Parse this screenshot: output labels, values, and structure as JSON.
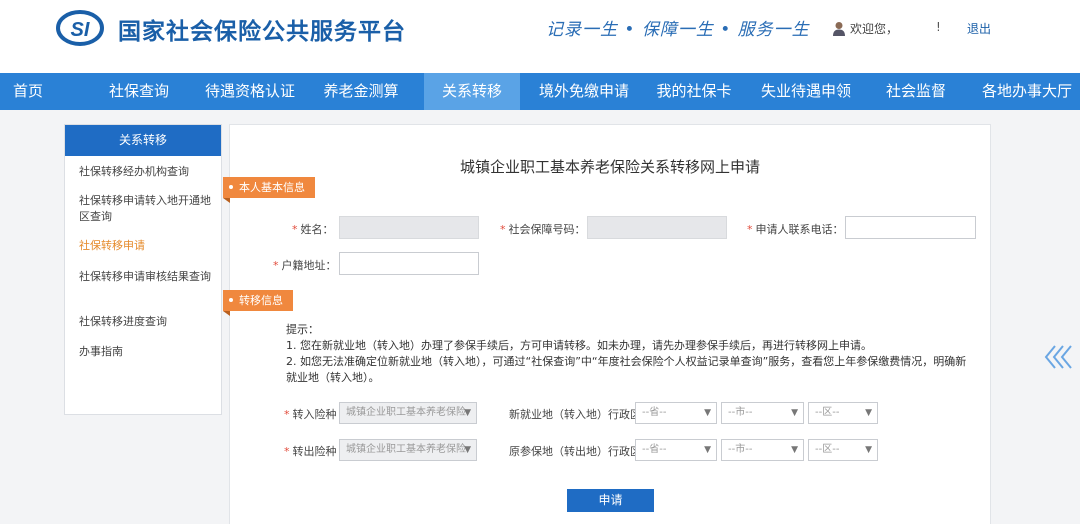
{
  "header": {
    "logo_text": "SI",
    "site_title": "国家社会保险公共服务平台",
    "slogan": "记录一生 • 保障一生 • 服务一生",
    "welcome": "欢迎您，",
    "bang": "!",
    "logout": "退出"
  },
  "nav": [
    {
      "label": "首页"
    },
    {
      "label": "社保查询"
    },
    {
      "label": "待遇资格认证"
    },
    {
      "label": "养老金测算"
    },
    {
      "label": "关系转移"
    },
    {
      "label": "境外免缴申请"
    },
    {
      "label": "我的社保卡"
    },
    {
      "label": "失业待遇申领"
    },
    {
      "label": "社会监督"
    },
    {
      "label": "各地办事大厅"
    }
  ],
  "sidebar": {
    "title": "关系转移",
    "items": [
      {
        "label": "社保转移经办机构查询"
      },
      {
        "label": "社保转移申请转入地开通地区查询"
      },
      {
        "label": "社保转移申请"
      },
      {
        "label": "社保转移申请审核结果查询"
      },
      {
        "label": "社保转移进度查询"
      },
      {
        "label": "办事指南"
      }
    ]
  },
  "form": {
    "title": "城镇企业职工基本养老保险关系转移网上申请",
    "section_basic": "本人基本信息",
    "section_transfer": "转移信息",
    "required_mark": "*",
    "name_label": "姓名：",
    "ssn_label": "社会保障号码：",
    "phone_label": "申请人联系电话：",
    "hukou_label": "户籍地址：",
    "tips": {
      "heading": "提示：",
      "line1": "1. 您在新就业地（转入地）办理了参保手续后，方可申请转移。如未办理，请先办理参保手续后，再进行转移网上申请。",
      "line2": "2. 如您无法准确定位新就业地（转入地），可通过“社保查询”中“年度社会保险个人权益记录单查询”服务，查看您上年参保缴费情况，明确新就业地（转入地）。"
    },
    "in_type_label": "转入险种",
    "out_type_label": "转出险种",
    "in_type_value": "城镇企业职工基本养老保险",
    "out_type_value": "城镇企业职工基本养老保险",
    "new_region_label": "新就业地（转入地）行政区",
    "old_region_label": "原参保地（转出地）行政区",
    "province_placeholder": "--省--",
    "city_placeholder": "--市--",
    "district_placeholder": "--区--",
    "submit": "申请"
  },
  "colors": {
    "brand": "#1a5fa8",
    "nav_bg": "#2a81d6",
    "nav_active": "#5aa3e6",
    "section_tag": "#f0883e",
    "sidebar_active": "#e58a2a",
    "button": "#1f6cc4"
  }
}
